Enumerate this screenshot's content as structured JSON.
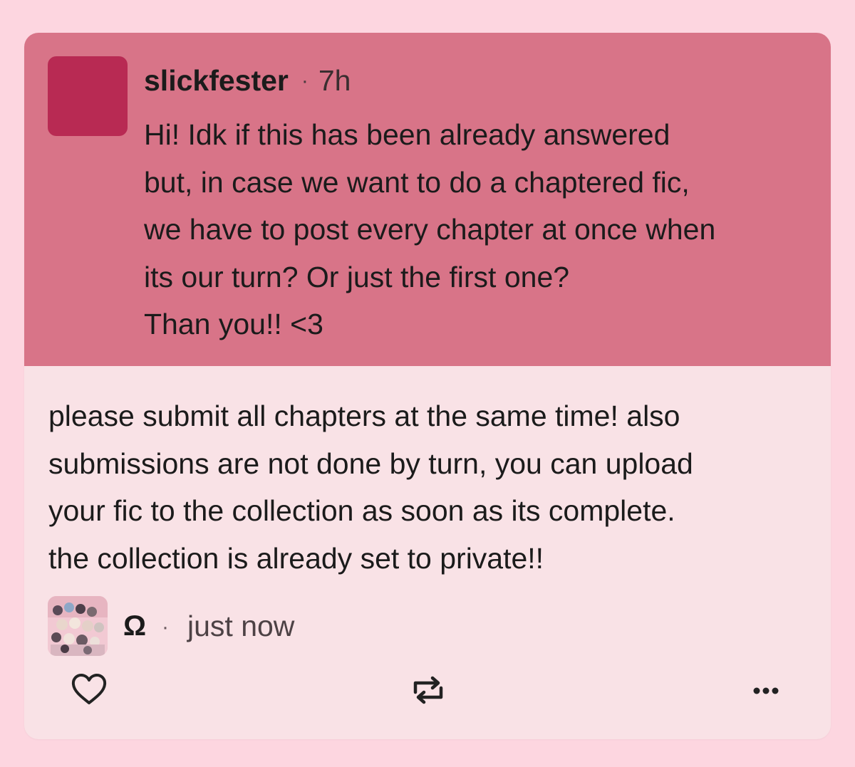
{
  "ask": {
    "asker_name": "slickfester",
    "separator": "·",
    "time": "7h",
    "lines": [
      "Hi! Idk if this has been already answered",
      "but, in case we want to do a chaptered fic,",
      "we have to post every chapter at once when",
      "its our turn? Or just the first one?",
      "Than you!! <3"
    ]
  },
  "answer": {
    "lines": [
      "please submit all chapters at the same time! also",
      "submissions are not done by turn, you can upload",
      "your fic to the collection as soon as its complete.",
      "the collection is already set to private!!"
    ],
    "answerer_name": "Ω",
    "separator": "·",
    "time": "just now"
  },
  "actions": {
    "like_icon": "heart-outline-icon",
    "reblog_icon": "reblog-icon",
    "more_icon": "more-options-icon"
  },
  "colors": {
    "page_background": "#fdd6e0",
    "ask_background": "#d87488",
    "asker_avatar": "#b82a53",
    "answer_background": "#f9e2e6"
  }
}
